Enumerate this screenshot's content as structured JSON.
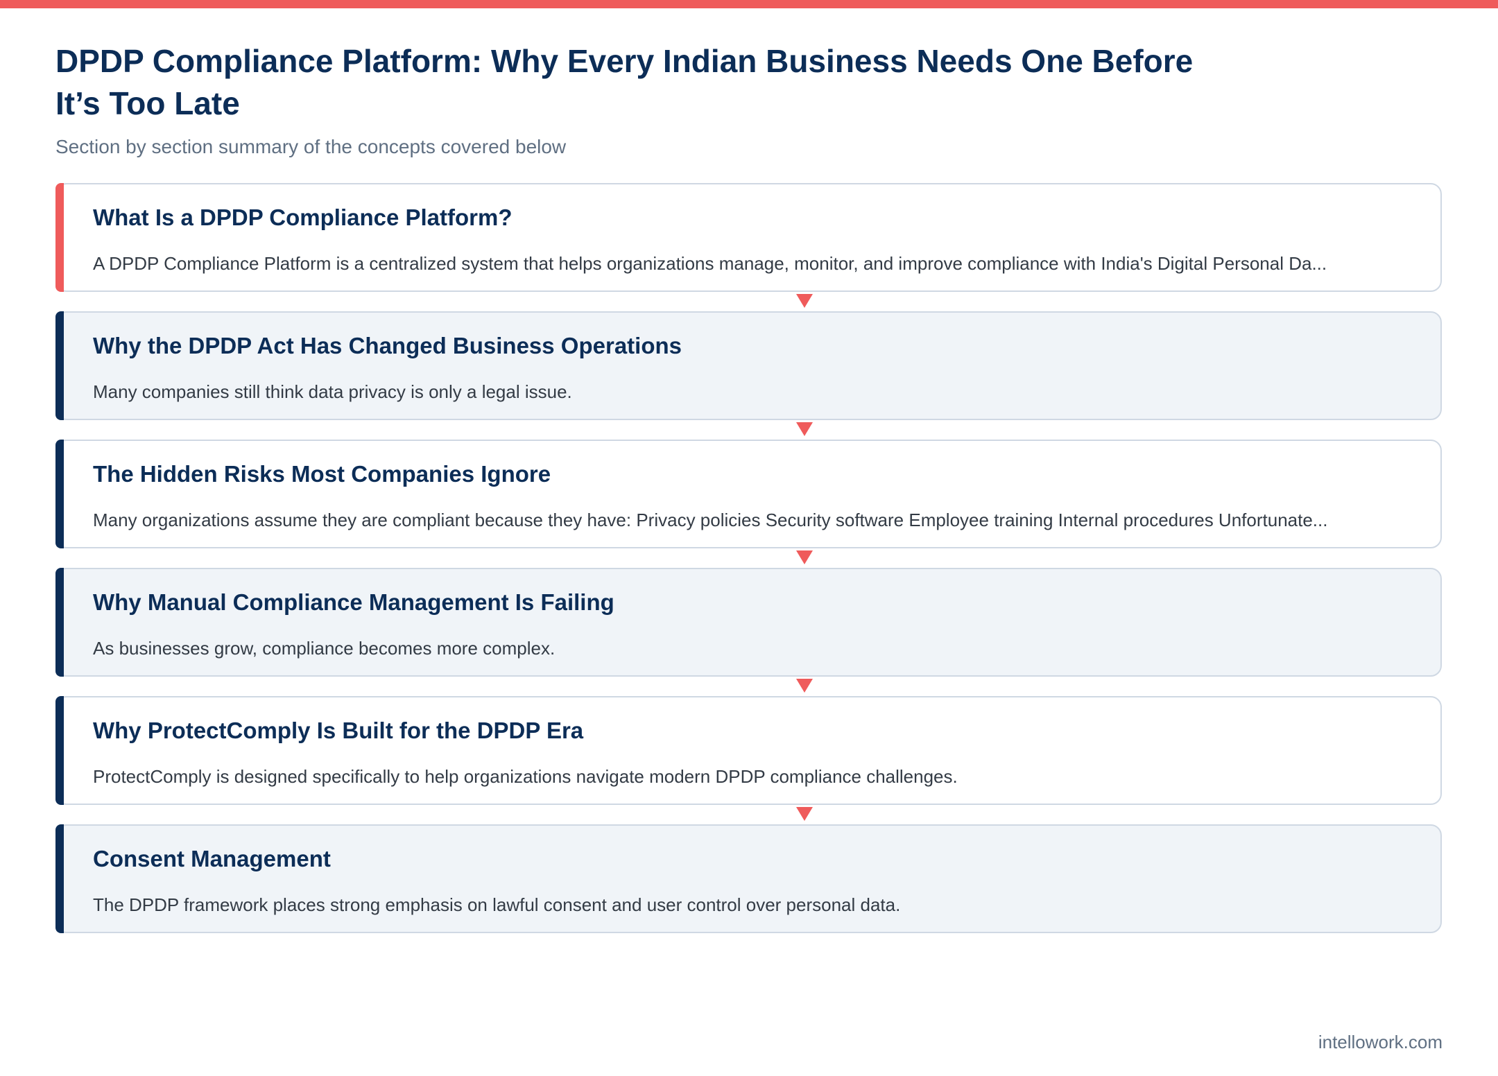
{
  "colors": {
    "accent": "#ef5b5b",
    "navy": "#0c2d57",
    "card_alt_background": "#f0f4f8",
    "card_border": "#cfd8e3"
  },
  "header": {
    "title": "DPDP Compliance Platform: Why Every Indian Business Needs One Before It’s Too Late",
    "subtitle": "Section by section summary of the concepts covered below"
  },
  "sections": [
    {
      "title": "What Is a DPDP Compliance Platform?",
      "text": "A DPDP Compliance Platform is a centralized system that helps organizations manage, monitor, and improve compliance with India's Digital Personal Da..."
    },
    {
      "title": "Why the DPDP Act Has Changed Business Operations",
      "text": "Many companies still think data privacy is only a legal issue."
    },
    {
      "title": "The Hidden Risks Most Companies Ignore",
      "text": "Many organizations assume they are compliant because they have: Privacy policies Security software Employee training Internal procedures Unfortunate..."
    },
    {
      "title": "Why Manual Compliance Management Is Failing",
      "text": "As businesses grow, compliance becomes more complex."
    },
    {
      "title": "Why ProtectComply Is Built for the DPDP Era",
      "text": "ProtectComply is designed specifically to help organizations navigate modern DPDP compliance challenges."
    },
    {
      "title": "Consent Management",
      "text": "The DPDP framework places strong emphasis on lawful consent and user control over personal data."
    }
  ],
  "footer": {
    "source": "intellowork.com"
  }
}
